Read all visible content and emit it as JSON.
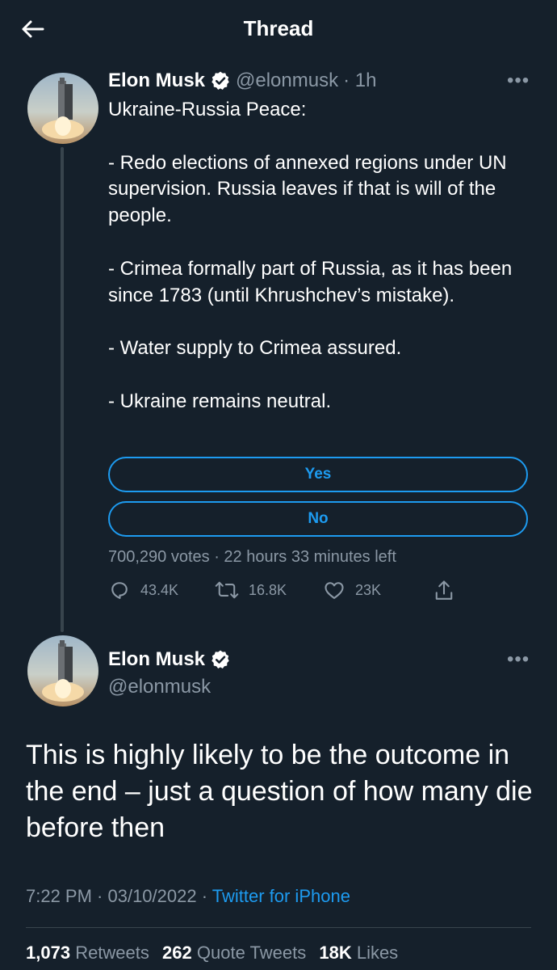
{
  "header": {
    "title": "Thread"
  },
  "tweet1": {
    "name": "Elon Musk",
    "handle": "@elonmusk",
    "time": "· 1h",
    "more": "•••",
    "text": "Ukraine-Russia Peace:\n\n- Redo elections of annexed regions under UN supervision. Russia leaves if that is will of the people.\n\n- Crimea formally part of Russia, as it has been since 1783 (until Khrushchev’s mistake).\n\n- Water supply to Crimea assured.\n\n- Ukraine remains neutral.",
    "poll": {
      "options": [
        "Yes",
        "No"
      ],
      "votes": "700,290 votes",
      "time_left": "· 22 hours 33 minutes left"
    },
    "actions": {
      "replies": "43.4K",
      "retweets": "16.8K",
      "likes": "23K"
    }
  },
  "tweet2": {
    "name": "Elon Musk",
    "handle": "@elonmusk",
    "more": "•••",
    "text": "This is highly likely to be the outcome in the end – just a question of how many die before then",
    "time": "7:22 PM · 03/10/2022 · ",
    "source": "Twitter for iPhone",
    "stats": {
      "retweets_count": "1,073",
      "retweets_label": "Retweets",
      "quotes_count": "262",
      "quotes_label": "Quote Tweets",
      "likes_count": "18K",
      "likes_label": "Likes"
    }
  },
  "colors": {
    "background": "#15202b",
    "accent": "#1d9bf0",
    "muted": "#8b98a5",
    "border": "#38444d"
  }
}
